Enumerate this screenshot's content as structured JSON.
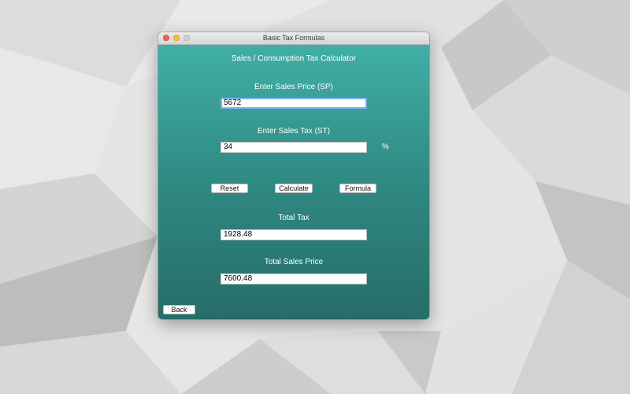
{
  "window": {
    "title": "Basic Tax Formulas"
  },
  "calculator": {
    "heading": "Sales / Consumption Tax Calculator",
    "sales_price_label": "Enter Sales Price (SP)",
    "sales_price_value": "5672",
    "sales_tax_label": "Enter Sales Tax (ST)",
    "sales_tax_value": "34",
    "sales_tax_unit": "%",
    "total_tax_label": "Total Tax",
    "total_tax_value": "1928.48",
    "total_sales_price_label": "Total Sales Price",
    "total_sales_price_value": "7600.48"
  },
  "buttons": {
    "reset": "Reset",
    "calculate": "Calculate",
    "formula": "Formula",
    "back": "Back"
  },
  "colors": {
    "gradient_top": "#40afa6",
    "gradient_bottom": "#276c68",
    "focus_ring": "#7eb1ea"
  }
}
